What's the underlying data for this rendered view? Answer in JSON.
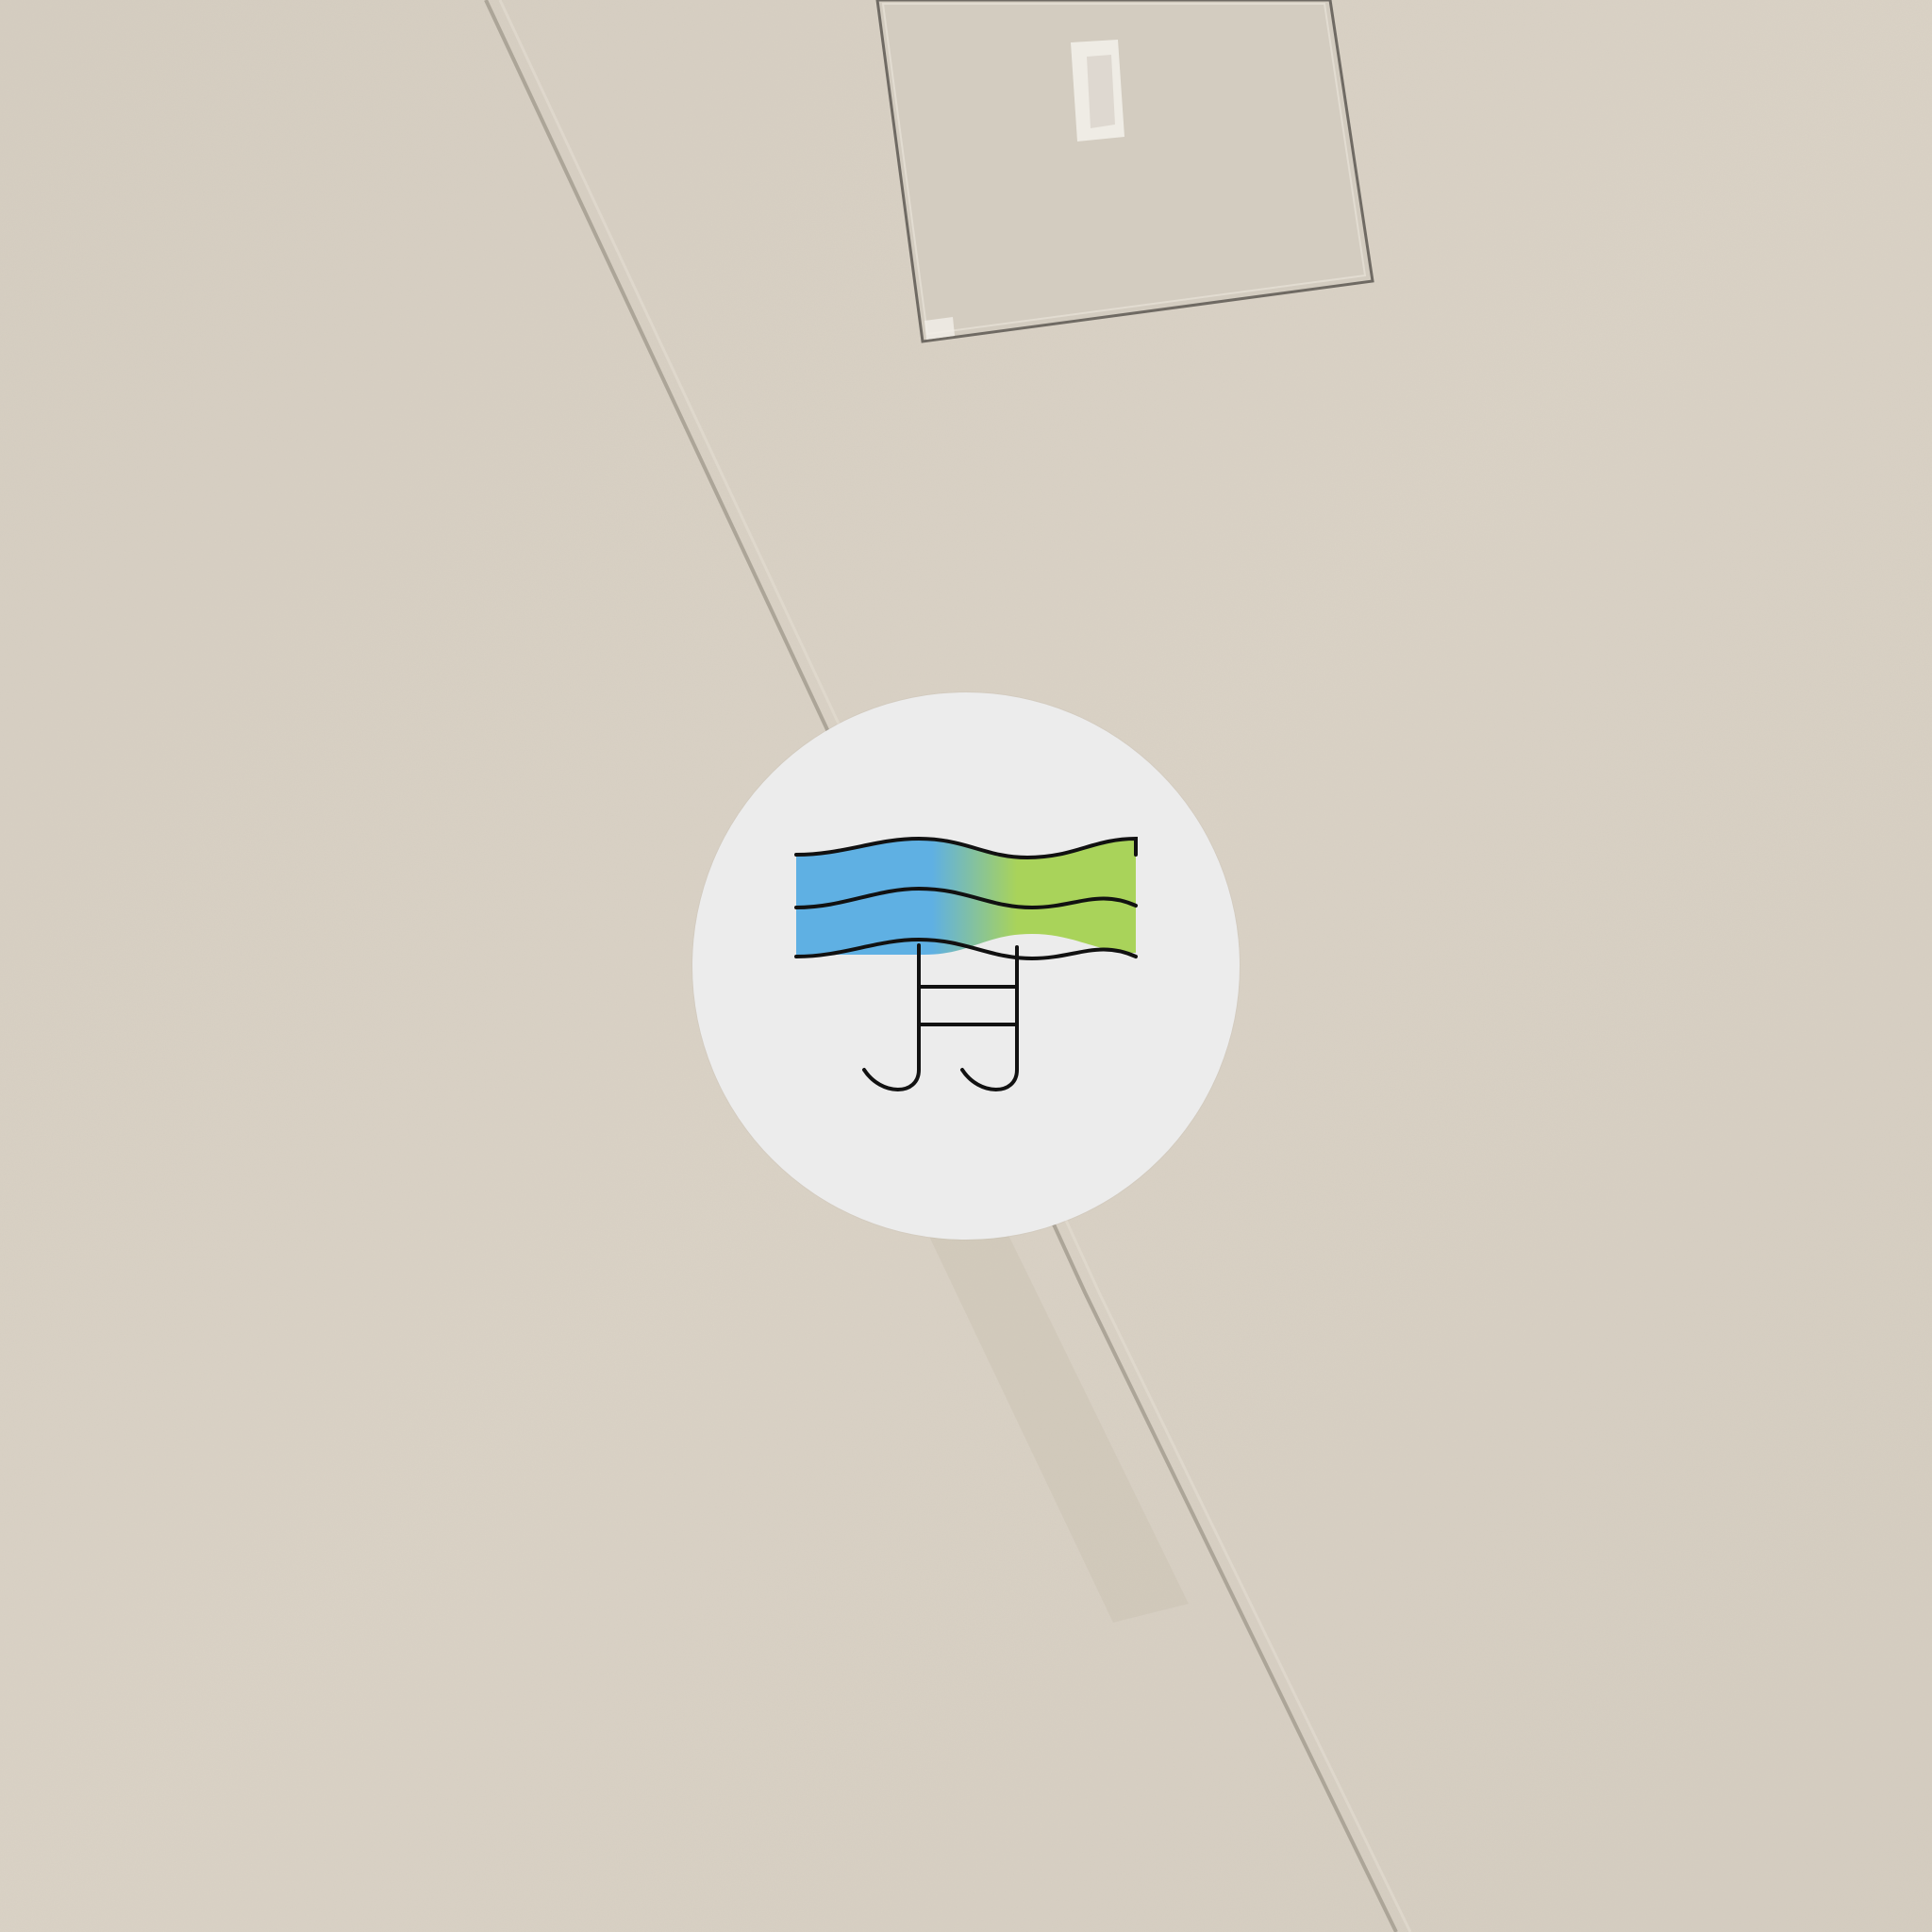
{
  "map": {
    "view": "satellite",
    "surface_color": "#d8d0c3",
    "marker": {
      "icon": "swimming-pool-icon",
      "background_color": "#ececec",
      "water_gradient": [
        "#5fb0e3",
        "#a9d35a"
      ],
      "stroke_color": "#111111"
    }
  }
}
